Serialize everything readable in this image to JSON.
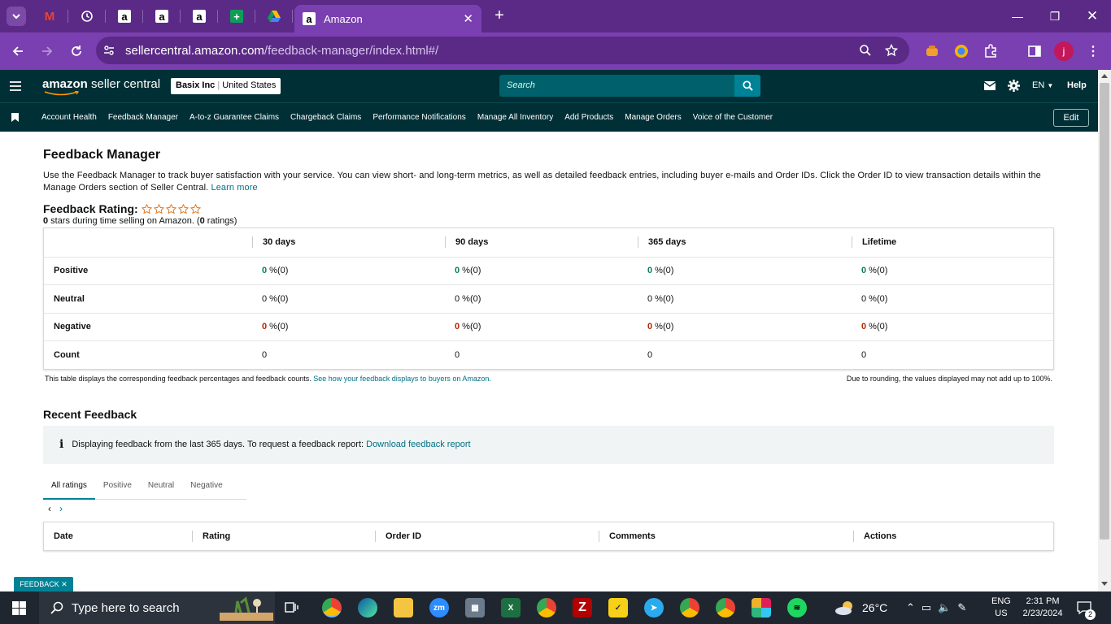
{
  "browser": {
    "active_tab_title": "Amazon",
    "url_host": "sellercentral.amazon.com",
    "url_path": "/feedback-manager/index.html#/",
    "profile_initial": "j"
  },
  "header": {
    "brand_a": "amazon",
    "brand_b": "seller central",
    "account_name": "Basix Inc",
    "account_region": "United States",
    "search_placeholder": "Search",
    "language": "EN",
    "help": "Help"
  },
  "nav": {
    "links": [
      "Account Health",
      "Feedback Manager",
      "A-to-z Guarantee Claims",
      "Chargeback Claims",
      "Performance Notifications",
      "Manage All Inventory",
      "Add Products",
      "Manage Orders",
      "Voice of the Customer"
    ],
    "edit": "Edit"
  },
  "page": {
    "title": "Feedback Manager",
    "description": "Use the Feedback Manager to track buyer satisfaction with your service. You can view short- and long-term metrics, as well as detailed feedback entries, including buyer e-mails and Order IDs. Click the Order ID to view transaction details within the Manage Orders section of Seller Central.",
    "learn_more": "Learn more",
    "rating_label": "Feedback Rating:",
    "stars_value": "0",
    "stars_text": " stars during time selling on Amazon. (",
    "ratings_count": "0",
    "ratings_text": " ratings)"
  },
  "feedback_table": {
    "columns": [
      "",
      "30 days",
      "90 days",
      "365 days",
      "Lifetime"
    ],
    "rows": [
      {
        "label": "Positive",
        "cells": [
          [
            "0",
            " %(0)"
          ],
          [
            "0",
            " %(0)"
          ],
          [
            "0",
            " %(0)"
          ],
          [
            "0",
            " %(0)"
          ]
        ]
      },
      {
        "label": "Neutral",
        "cells": [
          [
            "0",
            " %(0)"
          ],
          [
            "0",
            " %(0)"
          ],
          [
            "0",
            " %(0)"
          ],
          [
            "0",
            " %(0)"
          ]
        ]
      },
      {
        "label": "Negative",
        "cells": [
          [
            "0",
            " %(0)"
          ],
          [
            "0",
            " %(0)"
          ],
          [
            "0",
            " %(0)"
          ],
          [
            "0",
            " %(0)"
          ]
        ]
      },
      {
        "label": "Count",
        "cells": [
          [
            "0",
            ""
          ],
          [
            "0",
            ""
          ],
          [
            "0",
            ""
          ],
          [
            "0",
            ""
          ]
        ]
      }
    ],
    "note_left": "This table displays the corresponding feedback percentages and feedback counts.",
    "note_link": "See how your feedback displays to buyers on Amazon.",
    "note_right": "Due to rounding, the values displayed may not add up to 100%."
  },
  "recent": {
    "title": "Recent Feedback",
    "info_icon": "i",
    "info_text": "Displaying feedback from the last 365 days. To request a feedback report: ",
    "info_link": "Download feedback report",
    "tabs": [
      "All ratings",
      "Positive",
      "Neutral",
      "Negative"
    ],
    "columns": [
      "Date",
      "Rating",
      "Order ID",
      "Comments",
      "Actions"
    ]
  },
  "feedback_tag": "FEEDBACK",
  "taskbar": {
    "search_placeholder": "Type here to search",
    "weather": "26°C",
    "lang1": "ENG",
    "lang2": "US",
    "time": "2:31 PM",
    "date": "2/23/2024",
    "notifications": "2"
  },
  "colors": {
    "positive": "#067d62",
    "negative": "#b12704",
    "header_bg": "#002f36",
    "browser_purple": "#7a3fb0"
  }
}
